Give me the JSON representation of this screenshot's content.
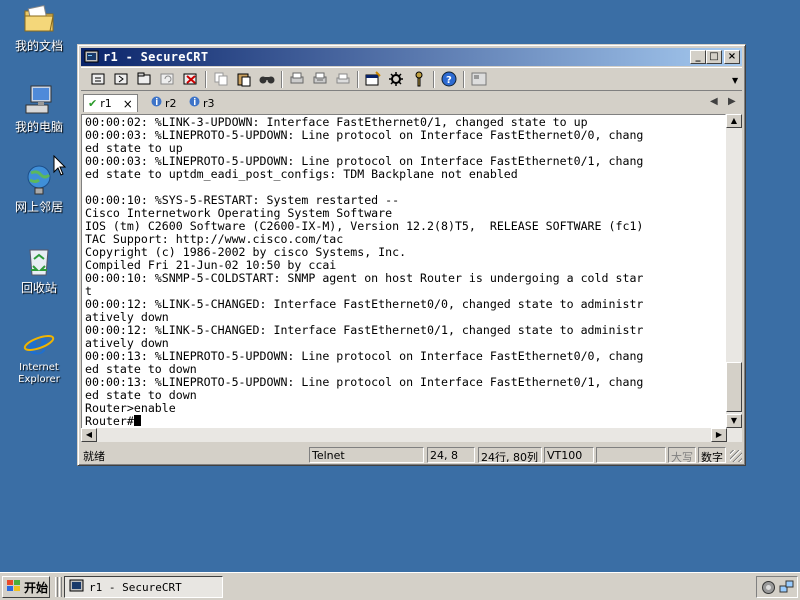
{
  "desktop": {
    "icons": [
      {
        "label": "我的文档",
        "icon": "my-documents-icon"
      },
      {
        "label": "我的电脑",
        "icon": "my-computer-icon"
      },
      {
        "label": "网上邻居",
        "icon": "network-places-icon"
      },
      {
        "label": "回收站",
        "icon": "recycle-bin-icon"
      },
      {
        "label_line1": "Internet",
        "label_line2": "Explorer",
        "icon": "internet-explorer-icon"
      }
    ]
  },
  "window": {
    "title": "r1 - SecureCRT",
    "controls": {
      "minimize": "_",
      "maximize": "□",
      "close": "×"
    },
    "tabs": [
      {
        "label": "r1",
        "close": "×",
        "active": true
      },
      {
        "label": "r2",
        "active": false
      },
      {
        "label": "r3",
        "active": false
      }
    ],
    "tab_nav": {
      "prev": "◀",
      "next": "▶"
    },
    "terminal": {
      "lines": [
        "00:00:02: %LINK-3-UPDOWN: Interface FastEthernet0/1, changed state to up",
        "00:00:03: %LINEPROTO-5-UPDOWN: Line protocol on Interface FastEthernet0/0, chang",
        "ed state to up",
        "00:00:03: %LINEPROTO-5-UPDOWN: Line protocol on Interface FastEthernet0/1, chang",
        "ed state to uptdm_eadi_post_configs: TDM Backplane not enabled",
        "",
        "00:00:10: %SYS-5-RESTART: System restarted --",
        "Cisco Internetwork Operating System Software",
        "IOS (tm) C2600 Software (C2600-IX-M), Version 12.2(8)T5,  RELEASE SOFTWARE (fc1)",
        "TAC Support: http://www.cisco.com/tac",
        "Copyright (c) 1986-2002 by cisco Systems, Inc.",
        "Compiled Fri 21-Jun-02 10:50 by ccai",
        "00:00:10: %SNMP-5-COLDSTART: SNMP agent on host Router is undergoing a cold star",
        "t",
        "00:00:12: %LINK-5-CHANGED: Interface FastEthernet0/0, changed state to administr",
        "atively down",
        "00:00:12: %LINK-5-CHANGED: Interface FastEthernet0/1, changed state to administr",
        "atively down",
        "00:00:13: %LINEPROTO-5-UPDOWN: Line protocol on Interface FastEthernet0/0, chang",
        "ed state to down",
        "00:00:13: %LINEPROTO-5-UPDOWN: Line protocol on Interface FastEthernet0/1, chang",
        "ed state to down",
        "Router>enable"
      ],
      "prompt": "Router#"
    },
    "status": {
      "ready": "就绪",
      "protocol": "Telnet",
      "cursor_pos": "24,  8",
      "size": "24行, 80列",
      "emulation": "VT100",
      "blank": "",
      "caps": "大写",
      "num": "数字"
    }
  },
  "taskbar": {
    "start_label": "开始",
    "task_label": "r1 - SecureCRT"
  },
  "colors": {
    "desktop": "#3a6ea5",
    "title_start": "#0a246a",
    "title_end": "#a6caf0",
    "chrome": "#d4d0c8"
  }
}
